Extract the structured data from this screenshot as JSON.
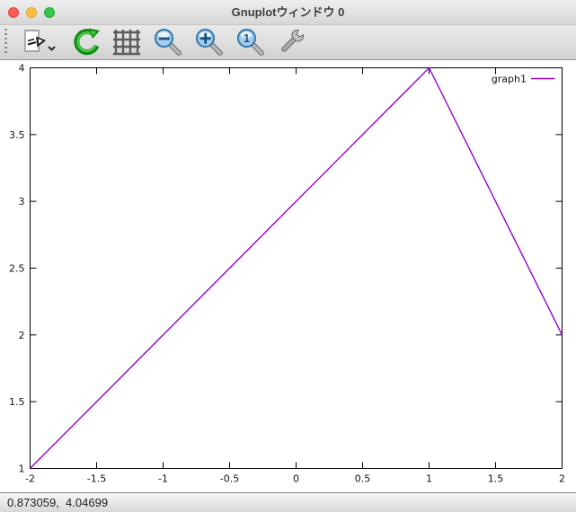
{
  "window": {
    "title": "Gnuplotウィンドウ 0"
  },
  "titlebar": {
    "traffic_lights": [
      {
        "name": "close",
        "color": "#fc5b57"
      },
      {
        "name": "minimize",
        "color": "#fdbe41"
      },
      {
        "name": "zoom",
        "color": "#34c84a"
      }
    ]
  },
  "toolbar": {
    "buttons": [
      {
        "name": "export",
        "icon": "export-icon"
      },
      {
        "name": "replot",
        "icon": "replot-icon"
      },
      {
        "name": "grid",
        "icon": "grid-icon"
      },
      {
        "name": "zoom-out",
        "icon": "zoom-out-icon"
      },
      {
        "name": "zoom-in",
        "icon": "zoom-in-icon"
      },
      {
        "name": "zoom-reset",
        "icon": "zoom-reset-icon"
      },
      {
        "name": "options",
        "icon": "wrench-icon"
      }
    ],
    "zoom_reset_glyph": "1"
  },
  "chart_data": {
    "type": "line",
    "title": "",
    "xlabel": "",
    "ylabel": "",
    "xlim": [
      -2,
      2
    ],
    "ylim": [
      1,
      4
    ],
    "xticks": [
      -2,
      -1.5,
      -1,
      -0.5,
      0,
      0.5,
      1,
      1.5,
      2
    ],
    "yticks": [
      1,
      1.5,
      2,
      2.5,
      3,
      3.5,
      4
    ],
    "grid": false,
    "legend_position": "top-right",
    "series": [
      {
        "name": "graph1",
        "color": "#9400d3",
        "points": [
          [
            -2,
            1
          ],
          [
            1,
            4
          ],
          [
            2,
            2
          ]
        ]
      }
    ]
  },
  "status": {
    "coordinates": "0.873059,  4.04699"
  }
}
